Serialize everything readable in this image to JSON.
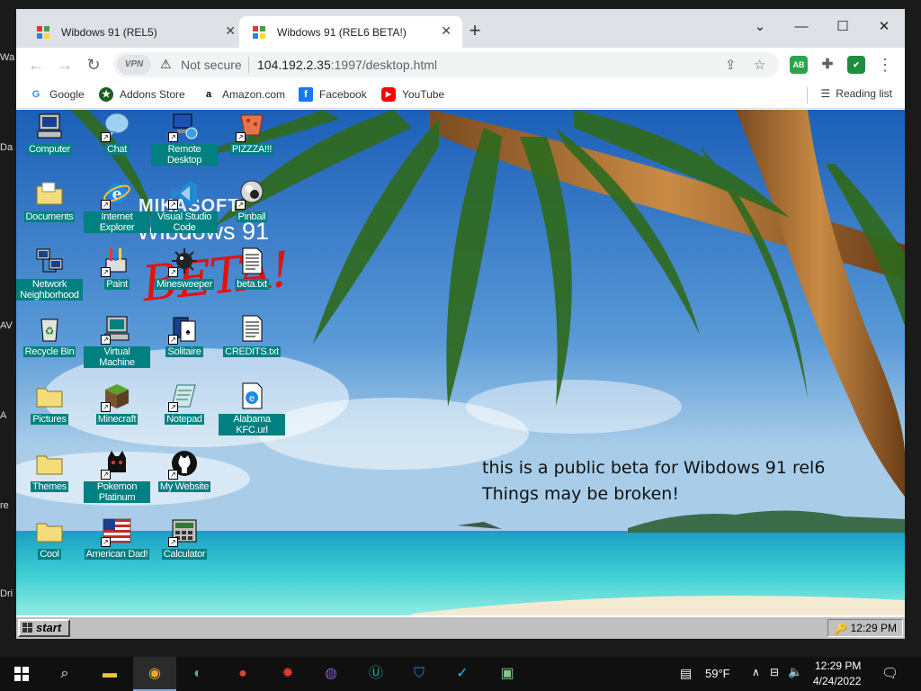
{
  "host_edge_labels": [
    "Wa",
    "Da",
    "AV",
    "A",
    "re",
    "Dri"
  ],
  "browser": {
    "tabs": [
      {
        "title": "Wibdows 91 (REL5)",
        "active": false
      },
      {
        "title": "Wibdows 91 (REL6 BETA!)",
        "active": true
      }
    ],
    "new_tab_label": "+",
    "window_controls": {
      "minimize": "—",
      "maximize": "☐",
      "close": "✕"
    },
    "tab_list_icon": "⌄",
    "vpn_label": "VPN",
    "security_text": "Not secure",
    "url_host": "104.192.2.35",
    "url_rest": ":1997/desktop.html",
    "extensions": [
      {
        "name": "adblock-extension-icon",
        "label": "AB",
        "color": "#2ba44a"
      },
      {
        "name": "puzzle-extensions-icon",
        "label": "✚",
        "color": "#5f6368"
      },
      {
        "name": "shield-extension-icon",
        "label": "✔",
        "color": "#1e8e3e"
      }
    ],
    "bookmarks": [
      {
        "label": "Google",
        "icon": "G",
        "color": "#4285f4"
      },
      {
        "label": "Addons Store",
        "icon": "★",
        "color": "#1b5e20"
      },
      {
        "label": "Amazon.com",
        "icon": "a",
        "color": "#000000"
      },
      {
        "label": "Facebook",
        "icon": "f",
        "color": "#1877f2"
      },
      {
        "label": "YouTube",
        "icon": "▶",
        "color": "#ff0000"
      }
    ],
    "reading_list": "Reading list"
  },
  "desktop": {
    "logo_text_line1": "MIKASOFT",
    "logo_text_line2": "Wibdows 91",
    "beta_stamp": "BETA!",
    "icons": [
      {
        "label": "Computer",
        "icon": "computer-icon",
        "shortcut": false
      },
      {
        "label": "Chat",
        "icon": "chat-bubble-icon",
        "shortcut": true
      },
      {
        "label": "Remote Desktop",
        "icon": "remote-desktop-icon",
        "shortcut": true
      },
      {
        "label": "PIZZZA!!!",
        "icon": "pizza-icon",
        "shortcut": true
      },
      {
        "label": "Documents",
        "icon": "folder-icon",
        "shortcut": false
      },
      {
        "label": "Internet Explorer",
        "icon": "internet-explorer-icon",
        "shortcut": true
      },
      {
        "label": "Visual Studio Code",
        "icon": "vscode-icon",
        "shortcut": true
      },
      {
        "label": "Pinball",
        "icon": "pinball-icon",
        "shortcut": true
      },
      {
        "label": "Network Neighborhood",
        "icon": "network-icon",
        "shortcut": false
      },
      {
        "label": "Paint",
        "icon": "paint-icon",
        "shortcut": true
      },
      {
        "label": "Minesweeper",
        "icon": "mine-icon",
        "shortcut": true
      },
      {
        "label": "beta.txt",
        "icon": "text-file-icon",
        "shortcut": false
      },
      {
        "label": "Recycle Bin",
        "icon": "recycle-bin-icon",
        "shortcut": false
      },
      {
        "label": "Virtual Machine",
        "icon": "virtual-machine-icon",
        "shortcut": true
      },
      {
        "label": "Solitaire",
        "icon": "cards-icon",
        "shortcut": true
      },
      {
        "label": "CREDITS.txt",
        "icon": "text-file-icon",
        "shortcut": false
      },
      {
        "label": "Pictures",
        "icon": "folder-icon",
        "shortcut": false
      },
      {
        "label": "Minecraft",
        "icon": "grass-block-icon",
        "shortcut": true
      },
      {
        "label": "Notepad",
        "icon": "notepad-icon",
        "shortcut": true
      },
      {
        "label": "Alabama KFC.url",
        "icon": "url-file-icon",
        "shortcut": false
      },
      {
        "label": "Themes",
        "icon": "folder-icon",
        "shortcut": false
      },
      {
        "label": "Pokemon Platinum",
        "icon": "pokemon-icon",
        "shortcut": true
      },
      {
        "label": "My Website",
        "icon": "github-icon",
        "shortcut": true
      },
      {
        "label": "Cool",
        "icon": "folder-icon",
        "shortcut": false
      },
      {
        "label": "American Dad!",
        "icon": "us-flag-icon",
        "shortcut": true
      },
      {
        "label": "Calculator",
        "icon": "calculator-icon",
        "shortcut": true
      }
    ],
    "beta_note_line1": "this is a public beta for Wibdows 91 rel6",
    "beta_note_line2": "Things may be broken!",
    "start_label": "start",
    "tray_time": "12:29 PM"
  },
  "win_taskbar": {
    "apps": [
      {
        "name": "file-explorer-icon",
        "glyph": "▬",
        "color": "#f0c040"
      },
      {
        "name": "browser-vpn-icon",
        "glyph": "◉",
        "color": "#f5a623",
        "active": true
      },
      {
        "name": "edge-icon",
        "glyph": "◐",
        "color": "#35c0a0"
      },
      {
        "name": "chrome-icon",
        "glyph": "●",
        "color": "#db4437"
      },
      {
        "name": "red-app-icon",
        "glyph": "✹",
        "color": "#e53935"
      },
      {
        "name": "purple-app-icon",
        "glyph": "◍",
        "color": "#7e57c2"
      },
      {
        "name": "u-app-icon",
        "glyph": "Ⓤ",
        "color": "#26a69a"
      },
      {
        "name": "shield-app-icon",
        "glyph": "⛉",
        "color": "#1e88e5"
      },
      {
        "name": "check-shield-app-icon",
        "glyph": "✓",
        "color": "#29b6f6"
      },
      {
        "name": "monitor-app-icon",
        "glyph": "▣",
        "color": "#81c784"
      }
    ],
    "weather": "59°F",
    "clock_time": "12:29 PM",
    "clock_date": "4/24/2022"
  }
}
